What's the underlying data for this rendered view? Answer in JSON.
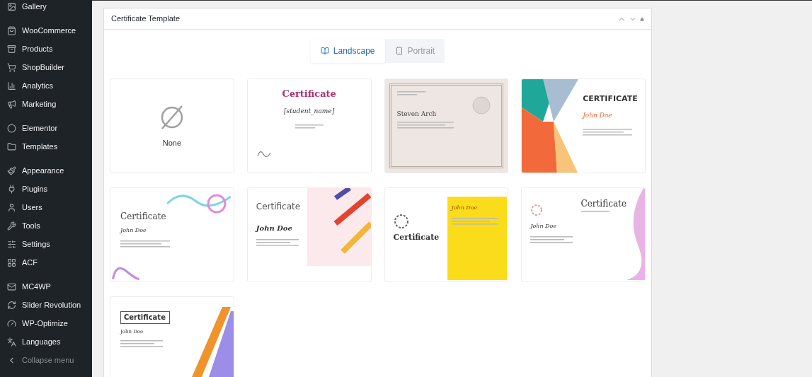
{
  "sidebar": {
    "groups": [
      {
        "items": [
          {
            "label": "Gallery",
            "kind": "link"
          }
        ]
      },
      {
        "items": [
          {
            "label": "WooCommerce",
            "kind": "link"
          },
          {
            "label": "Products",
            "kind": "link"
          },
          {
            "label": "ShopBuilder",
            "kind": "link"
          },
          {
            "label": "Analytics",
            "kind": "link"
          },
          {
            "label": "Marketing",
            "kind": "link"
          }
        ]
      },
      {
        "items": [
          {
            "label": "Elementor",
            "kind": "link"
          },
          {
            "label": "Templates",
            "kind": "link"
          }
        ]
      },
      {
        "items": [
          {
            "label": "Appearance",
            "kind": "link"
          },
          {
            "label": "Plugins",
            "kind": "link"
          },
          {
            "label": "Users",
            "kind": "link"
          },
          {
            "label": "Tools",
            "kind": "link"
          },
          {
            "label": "Settings",
            "kind": "link"
          },
          {
            "label": "ACF",
            "kind": "link"
          }
        ]
      },
      {
        "items": [
          {
            "label": "MC4WP",
            "kind": "link"
          },
          {
            "label": "Slider Revolution",
            "kind": "link"
          },
          {
            "label": "WP-Optimize",
            "kind": "link"
          },
          {
            "label": "Languages",
            "kind": "link"
          },
          {
            "label": "Collapse menu",
            "kind": "collapse"
          }
        ]
      }
    ]
  },
  "panel": {
    "title": "Certificate Template",
    "orientation_tabs": [
      {
        "label": "Landscape",
        "selected": true
      },
      {
        "label": "Portrait",
        "selected": false
      }
    ],
    "templates": [
      {
        "kind": "none",
        "label": "None"
      },
      {
        "kind": "classic",
        "title": "Certificate",
        "name": "[student_name]"
      },
      {
        "kind": "bordered",
        "name": "Steven Arch"
      },
      {
        "kind": "geometric",
        "title": "CERTIFICATE",
        "name": "John Doe"
      },
      {
        "kind": "floral",
        "title": "Certificate",
        "name": "John Doe"
      },
      {
        "kind": "stripes",
        "title": "Certificate",
        "name": "John Doe"
      },
      {
        "kind": "yellow",
        "title": "Certificate",
        "name": "John Doe"
      },
      {
        "kind": "ribbon",
        "title": "Certificate",
        "name": "John Doe"
      },
      {
        "kind": "diagonal",
        "title": "Certificate",
        "name": "John Doe"
      }
    ]
  }
}
